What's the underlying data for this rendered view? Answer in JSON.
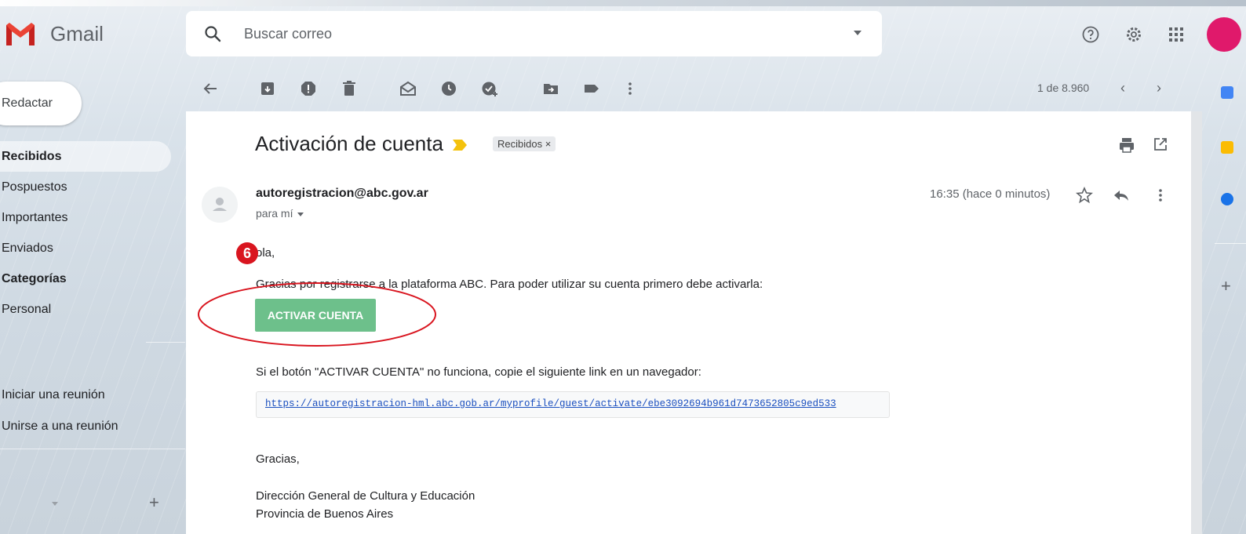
{
  "app": {
    "name": "Gmail",
    "logo_icon": "gmail-logo-icon"
  },
  "search": {
    "placeholder": "Buscar correo",
    "icon": "search-icon"
  },
  "header_icons": [
    "help-icon",
    "gear-icon",
    "apps-grid-icon"
  ],
  "compose": {
    "label": "Redactar"
  },
  "sidebar": {
    "items": [
      {
        "label": "Recibidos",
        "active": true
      },
      {
        "label": "Pospuestos"
      },
      {
        "label": "Importantes"
      },
      {
        "label": "Enviados"
      },
      {
        "label": "Categorías",
        "bold": true
      },
      {
        "label": "Personal"
      }
    ],
    "meet": [
      "Iniciar una reunión",
      "Unirse a una reunión"
    ]
  },
  "toolbar": {
    "icons": [
      "back-arrow-icon",
      "archive-icon",
      "report-spam-icon",
      "delete-icon",
      "mark-unread-icon",
      "snooze-icon",
      "add-task-icon",
      "move-to-icon",
      "label-icon",
      "more-vert-icon"
    ],
    "pager": "1 de 8.960"
  },
  "message": {
    "subject": "Activación de cuenta",
    "label": "Recibidos",
    "label_close": "×",
    "sender": "autoregistracion@abc.gov.ar",
    "to": "para mí",
    "time": "16:35 (hace 0 minutos)",
    "greeting": "ola,",
    "intro": "Gracias por registrarse a la plataforma ABC. Para poder utilizar su cuenta primero debe activarla:",
    "button_label": "ACTIVAR CUENTA",
    "fallback_text": "Si el botón \"ACTIVAR CUENTA\" no funciona, copie el siguiente link en un navegador:",
    "link": "https://autoregistracion-hml.abc.gob.ar/myprofile/guest/activate/ebe3092694b961d7473652805c9ed533",
    "thanks": "Gracias,",
    "signature_line1": "Dirección General de Cultura y Educación",
    "signature_line2": "Provincia de Buenos Aires"
  },
  "annotation": {
    "step_number": "6",
    "color": "#d9151f"
  },
  "colors": {
    "accent_button": "#6dc08b",
    "avatar": "#e0196b",
    "link": "#1a4fbf"
  }
}
